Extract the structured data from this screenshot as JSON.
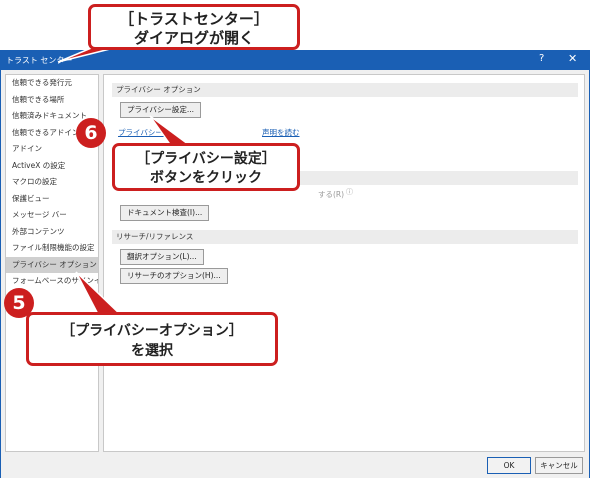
{
  "window": {
    "title": "トラスト センター",
    "help_glyph": "?",
    "close_glyph": "✕"
  },
  "sidebar": {
    "items": [
      {
        "label": "信頼できる発行元"
      },
      {
        "label": "信頼できる場所"
      },
      {
        "label": "信頼済みドキュメント"
      },
      {
        "label": "信頼できるアドイン カタログ"
      },
      {
        "label": "アドイン"
      },
      {
        "label": "ActiveX の設定"
      },
      {
        "label": "マクロの設定"
      },
      {
        "label": "保護ビュー"
      },
      {
        "label": "メッセージ バー"
      },
      {
        "label": "外部コンテンツ"
      },
      {
        "label": "ファイル制限機能の設定"
      },
      {
        "label": "プライバシー オプション"
      },
      {
        "label": "フォームベースのサインイン"
      }
    ],
    "selected_index": 11
  },
  "main": {
    "privacy_section": {
      "header": "プライバシー オプション",
      "settings_button": "プライバシー設定...",
      "link_left": "プライバシーに",
      "link_right": "声明を読む"
    },
    "hidden_row_hint": "する(R)",
    "doc_inspector_button": "ドキュメント検査(I)...",
    "research_section": {
      "header": "リサーチ/リファレンス",
      "translation_button": "翻訳オプション(L)...",
      "research_button": "リサーチのオプション(H)..."
    }
  },
  "footer": {
    "ok_label": "OK",
    "cancel_label": "キャンセル"
  },
  "annotations": {
    "top_callout": {
      "line1": "［トラストセンター］",
      "line2": "ダイアログが開く"
    },
    "step6": {
      "number": "6",
      "line1": "［プライバシー設定］",
      "line2": "ボタンをクリック"
    },
    "step5": {
      "number": "5",
      "line1": "［プライバシーオプション］",
      "line2": "を選択"
    }
  },
  "colors": {
    "titlebar": "#1a5fb4",
    "callout_border": "#cc1f1f",
    "selection": "#cfcfcf"
  }
}
